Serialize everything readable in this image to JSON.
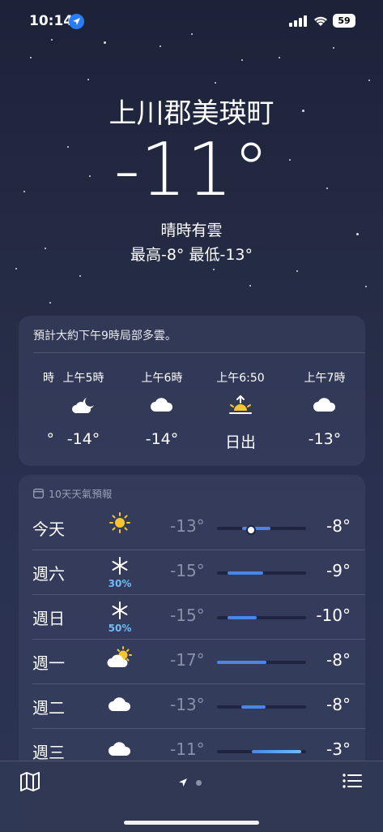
{
  "status": {
    "time": "10:14",
    "battery": "59"
  },
  "location": {
    "city": "上川郡美瑛町",
    "temperature": "-11°",
    "condition": "晴時有雲",
    "high_low": "最高-8° 最低-13°"
  },
  "hourly": {
    "summary": "預計大約下午9時局部多雲。",
    "items": [
      {
        "label": "時",
        "icon": "partial",
        "temp": "°"
      },
      {
        "label": "上午5時",
        "icon": "moon-cloud-icon",
        "temp": "-14°"
      },
      {
        "label": "上午6時",
        "icon": "cloud-icon",
        "temp": "-14°"
      },
      {
        "label": "上午6:50",
        "icon": "sunrise-icon",
        "temp": "日出"
      },
      {
        "label": "上午7時",
        "icon": "cloud-icon",
        "temp": "-13°"
      }
    ]
  },
  "forecast": {
    "title": "10天天氣預報",
    "days": [
      {
        "day": "今天",
        "icon": "sun-icon",
        "precip": "",
        "low": "-13°",
        "high": "-8°",
        "bar_start": 0.28,
        "bar_end": 0.6,
        "current": 0.38
      },
      {
        "day": "週六",
        "icon": "snow-icon",
        "precip": "30%",
        "low": "-15°",
        "high": "-9°",
        "bar_start": 0.12,
        "bar_end": 0.52
      },
      {
        "day": "週日",
        "icon": "snow-icon",
        "precip": "50%",
        "low": "-15°",
        "high": "-10°",
        "bar_start": 0.12,
        "bar_end": 0.45
      },
      {
        "day": "週一",
        "icon": "sun-cloud-icon",
        "precip": "",
        "low": "-17°",
        "high": "-8°",
        "bar_start": 0.0,
        "bar_end": 0.55
      },
      {
        "day": "週二",
        "icon": "cloud-icon",
        "precip": "",
        "low": "-13°",
        "high": "-8°",
        "bar_start": 0.27,
        "bar_end": 0.55
      },
      {
        "day": "週三",
        "icon": "cloud-icon",
        "precip": "",
        "low": "-11°",
        "high": "-3°",
        "bar_start": 0.39,
        "bar_end": 0.95
      }
    ]
  },
  "colors": {
    "accent": "#2a7cf6",
    "bar": "#4a86e8",
    "precip": "#6fbdf4"
  }
}
